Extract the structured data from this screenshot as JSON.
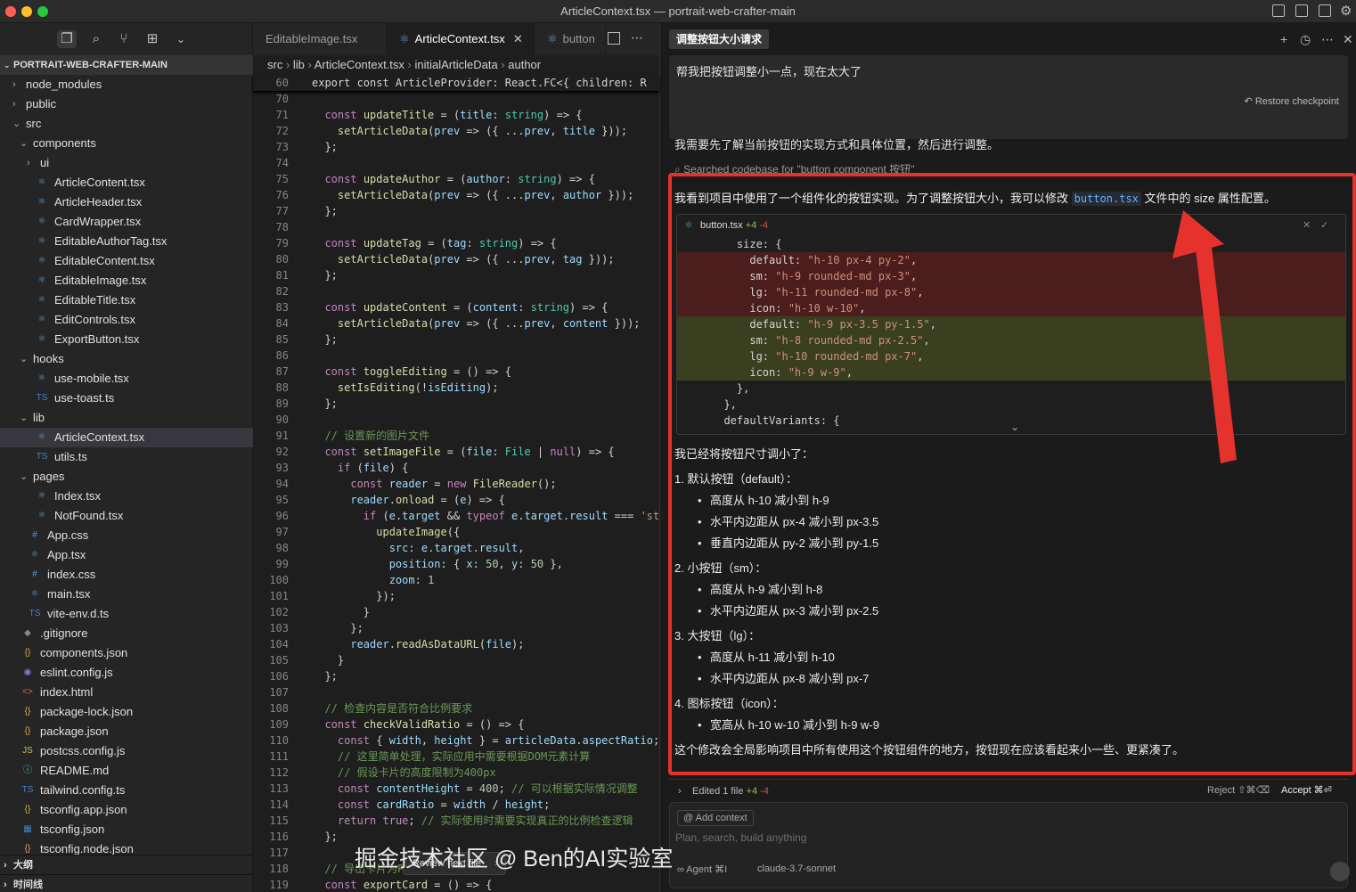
{
  "window": {
    "title": "ArticleContext.tsx — portrait-web-crafter-main"
  },
  "colors": {
    "accent": "#e5322d",
    "editor_bg": "#1e1e1e",
    "sidebar_bg": "#252526",
    "selected": "#37373d",
    "diff_removed": "#4b1d1d",
    "diff_added": "#3a3f1f"
  },
  "sidebar": {
    "header": "PORTRAIT-WEB-CRAFTER-MAIN",
    "tree": [
      {
        "label": "node_modules",
        "kind": "folder",
        "depth": 0,
        "open": false
      },
      {
        "label": "public",
        "kind": "folder",
        "depth": 0,
        "open": false
      },
      {
        "label": "src",
        "kind": "folder",
        "depth": 0,
        "open": true
      },
      {
        "label": "components",
        "kind": "folder",
        "depth": 1,
        "open": true
      },
      {
        "label": "ui",
        "kind": "folder",
        "depth": 2,
        "open": false
      },
      {
        "label": "ArticleContent.tsx",
        "kind": "react",
        "depth": 2
      },
      {
        "label": "ArticleHeader.tsx",
        "kind": "react",
        "depth": 2
      },
      {
        "label": "CardWrapper.tsx",
        "kind": "react",
        "depth": 2
      },
      {
        "label": "EditableAuthorTag.tsx",
        "kind": "react",
        "depth": 2
      },
      {
        "label": "EditableContent.tsx",
        "kind": "react",
        "depth": 2
      },
      {
        "label": "EditableImage.tsx",
        "kind": "react",
        "depth": 2
      },
      {
        "label": "EditableTitle.tsx",
        "kind": "react",
        "depth": 2
      },
      {
        "label": "EditControls.tsx",
        "kind": "react",
        "depth": 2
      },
      {
        "label": "ExportButton.tsx",
        "kind": "react",
        "depth": 2
      },
      {
        "label": "hooks",
        "kind": "folder",
        "depth": 1,
        "open": true
      },
      {
        "label": "use-mobile.tsx",
        "kind": "react",
        "depth": 2
      },
      {
        "label": "use-toast.ts",
        "kind": "ts",
        "depth": 2
      },
      {
        "label": "lib",
        "kind": "folder",
        "depth": 1,
        "open": true
      },
      {
        "label": "ArticleContext.tsx",
        "kind": "react",
        "depth": 2,
        "selected": true
      },
      {
        "label": "utils.ts",
        "kind": "ts",
        "depth": 2
      },
      {
        "label": "pages",
        "kind": "folder",
        "depth": 1,
        "open": true
      },
      {
        "label": "Index.tsx",
        "kind": "react",
        "depth": 2
      },
      {
        "label": "NotFound.tsx",
        "kind": "react",
        "depth": 2
      },
      {
        "label": "App.css",
        "kind": "css",
        "depth": 1
      },
      {
        "label": "App.tsx",
        "kind": "react",
        "depth": 1
      },
      {
        "label": "index.css",
        "kind": "css",
        "depth": 1
      },
      {
        "label": "main.tsx",
        "kind": "react",
        "depth": 1
      },
      {
        "label": "vite-env.d.ts",
        "kind": "ts",
        "depth": 1
      },
      {
        "label": ".gitignore",
        "kind": "git",
        "depth": 0
      },
      {
        "label": "components.json",
        "kind": "json",
        "depth": 0
      },
      {
        "label": "eslint.config.js",
        "kind": "eslint",
        "depth": 0
      },
      {
        "label": "index.html",
        "kind": "html",
        "depth": 0
      },
      {
        "label": "package-lock.json",
        "kind": "json",
        "depth": 0
      },
      {
        "label": "package.json",
        "kind": "json",
        "depth": 0
      },
      {
        "label": "postcss.config.js",
        "kind": "js",
        "depth": 0
      },
      {
        "label": "README.md",
        "kind": "info",
        "depth": 0
      },
      {
        "label": "tailwind.config.ts",
        "kind": "ts",
        "depth": 0
      },
      {
        "label": "tsconfig.app.json",
        "kind": "json",
        "depth": 0
      },
      {
        "label": "tsconfig.json",
        "kind": "tsconfig",
        "depth": 0
      },
      {
        "label": "tsconfig.node.json",
        "kind": "json",
        "depth": 0
      }
    ],
    "outline": "大纲",
    "timeline": "时间线"
  },
  "editor": {
    "tabs": [
      {
        "label": "EditableImage.tsx",
        "active": false
      },
      {
        "label": "ArticleContext.tsx",
        "active": true
      },
      {
        "label": "button",
        "active": false
      }
    ],
    "breadcrumb": [
      "src",
      "lib",
      "ArticleContext.tsx",
      "initialArticleData",
      "author"
    ],
    "sticky_line": {
      "num": "60",
      "text": "export const ArticleProvider: React.FC<{ children: R"
    },
    "lines": [
      {
        "n": "70",
        "h": ""
      },
      {
        "n": "71",
        "h": "  <span class='k'>const</span> <span class='f'>updateTitle</span> = (<span class='v'>title</span>: <span class='t'>string</span>) => {"
      },
      {
        "n": "72",
        "h": "    <span class='f'>setArticleData</span>(<span class='v'>prev</span> => ({ ...<span class='v'>prev</span>, <span class='v'>title</span> }));"
      },
      {
        "n": "73",
        "h": "  };"
      },
      {
        "n": "74",
        "h": ""
      },
      {
        "n": "75",
        "h": "  <span class='k'>const</span> <span class='f'>updateAuthor</span> = (<span class='v'>author</span>: <span class='t'>string</span>) => {"
      },
      {
        "n": "76",
        "h": "    <span class='f'>setArticleData</span>(<span class='v'>prev</span> => ({ ...<span class='v'>prev</span>, <span class='v'>author</span> }));"
      },
      {
        "n": "77",
        "h": "  };"
      },
      {
        "n": "78",
        "h": ""
      },
      {
        "n": "79",
        "h": "  <span class='k'>const</span> <span class='f'>updateTag</span> = (<span class='v'>tag</span>: <span class='t'>string</span>) => {"
      },
      {
        "n": "80",
        "h": "    <span class='f'>setArticleData</span>(<span class='v'>prev</span> => ({ ...<span class='v'>prev</span>, <span class='v'>tag</span> }));"
      },
      {
        "n": "81",
        "h": "  };"
      },
      {
        "n": "82",
        "h": ""
      },
      {
        "n": "83",
        "h": "  <span class='k'>const</span> <span class='f'>updateContent</span> = (<span class='v'>content</span>: <span class='t'>string</span>) => {"
      },
      {
        "n": "84",
        "h": "    <span class='f'>setArticleData</span>(<span class='v'>prev</span> => ({ ...<span class='v'>prev</span>, <span class='v'>content</span> }));"
      },
      {
        "n": "85",
        "h": "  };"
      },
      {
        "n": "86",
        "h": ""
      },
      {
        "n": "87",
        "h": "  <span class='k'>const</span> <span class='f'>toggleEditing</span> = () => {"
      },
      {
        "n": "88",
        "h": "    <span class='f'>setIsEditing</span>(!<span class='v'>isEditing</span>);"
      },
      {
        "n": "89",
        "h": "  };"
      },
      {
        "n": "90",
        "h": ""
      },
      {
        "n": "91",
        "h": "  <span class='c'>// 设置新的图片文件</span>"
      },
      {
        "n": "92",
        "h": "  <span class='k'>const</span> <span class='f'>setImageFile</span> = (<span class='v'>file</span>: <span class='t'>File</span> | <span class='k'>null</span>) => {"
      },
      {
        "n": "93",
        "h": "    <span class='k'>if</span> (<span class='v'>file</span>) {"
      },
      {
        "n": "94",
        "h": "      <span class='k'>const</span> <span class='v'>reader</span> = <span class='k'>new</span> <span class='f'>FileReader</span>();"
      },
      {
        "n": "95",
        "h": "      <span class='v'>reader</span>.<span class='f'>onload</span> = (<span class='v'>e</span>) => {"
      },
      {
        "n": "96",
        "h": "        <span class='k'>if</span> (<span class='v'>e</span>.<span class='v'>target</span> && <span class='k'>typeof</span> <span class='v'>e</span>.<span class='v'>target</span>.<span class='v'>result</span> === <span class='s'>'st</span>"
      },
      {
        "n": "97",
        "h": "          <span class='f'>updateImage</span>({"
      },
      {
        "n": "98",
        "h": "            <span class='v'>src</span>: <span class='v'>e</span>.<span class='v'>target</span>.<span class='v'>result</span>,"
      },
      {
        "n": "99",
        "h": "            <span class='v'>position</span>: { <span class='v'>x</span>: <span class='n'>50</span>, <span class='v'>y</span>: <span class='n'>50</span> },"
      },
      {
        "n": "100",
        "h": "            <span class='v'>zoom</span>: <span class='n'>1</span>"
      },
      {
        "n": "101",
        "h": "          });"
      },
      {
        "n": "102",
        "h": "        }"
      },
      {
        "n": "103",
        "h": "      };"
      },
      {
        "n": "104",
        "h": "      <span class='v'>reader</span>.<span class='f'>readAsDataURL</span>(<span class='v'>file</span>);"
      },
      {
        "n": "105",
        "h": "    }"
      },
      {
        "n": "106",
        "h": "  };"
      },
      {
        "n": "107",
        "h": ""
      },
      {
        "n": "108",
        "h": "  <span class='c'>// 检查内容是否符合比例要求</span>"
      },
      {
        "n": "109",
        "h": "  <span class='k'>const</span> <span class='f'>checkValidRatio</span> = () => {"
      },
      {
        "n": "110",
        "h": "    <span class='k'>const</span> { <span class='v'>width</span>, <span class='v'>height</span> } = <span class='v'>articleData</span>.<span class='v'>aspectRatio</span>;"
      },
      {
        "n": "111",
        "h": "    <span class='c'>// 这里简单处理，实际应用中需要根据DOM元素计算</span>"
      },
      {
        "n": "112",
        "h": "    <span class='c'>// 假设卡片的高度限制为400px</span>"
      },
      {
        "n": "113",
        "h": "    <span class='k'>const</span> <span class='v'>contentHeight</span> = <span class='n'>400</span>; <span class='c'>// 可以根据实际情况调整</span>"
      },
      {
        "n": "114",
        "h": "    <span class='k'>const</span> <span class='v'>cardRatio</span> = <span class='v'>width</span> / <span class='v'>height</span>;"
      },
      {
        "n": "115",
        "h": "    <span class='k'>return</span> <span class='k'>true</span>; <span class='c'>// 实际使用时需要实现真正的比例检查逻辑</span>"
      },
      {
        "n": "116",
        "h": "  };"
      },
      {
        "n": "117",
        "h": ""
      },
      {
        "n": "118",
        "h": "  <span class='c'>// 导出卡片为P</span>"
      },
      {
        "n": "119",
        "h": "  <span class='k'>const</span> <span class='f'>exportCard</span> = () => {"
      }
    ],
    "review_next": "Review next file"
  },
  "chat": {
    "tab_title": "调整按钮大小请求",
    "user_message": "帮我把按钮调整小一点，现在太大了",
    "restore": "Restore checkpoint",
    "intro": "我需要先了解当前按钮的实现方式和具体位置，然后进行调整。",
    "searched": "Searched codebase for \"button component 按钮\"",
    "found_pre": "我看到项目中使用了一个组件化的按钮实现。为了调整按钮大小，我可以修改",
    "found_code": "button.tsx",
    "found_post": "文件中的 size 属性配置。",
    "diff": {
      "file": "button.tsx",
      "added": "+4",
      "removed": "-4",
      "lines": [
        {
          "type": "ctx",
          "h": "    size: {"
        },
        {
          "type": "del",
          "h": "      default: <span class='s'>\"h-10 px-4 py-2\"</span>,"
        },
        {
          "type": "del",
          "h": "      sm: <span class='s'>\"h-9 rounded-md px-3\"</span>,"
        },
        {
          "type": "del",
          "h": "      lg: <span class='s'>\"h-11 rounded-md px-8\"</span>,"
        },
        {
          "type": "del",
          "h": "      icon: <span class='s'>\"h-10 w-10\"</span>,"
        },
        {
          "type": "add",
          "h": "      default: <span class='s'>\"h-9 px-3.5 py-1.5\"</span>,"
        },
        {
          "type": "add",
          "h": "      sm: <span class='s'>\"h-8 rounded-md px-2.5\"</span>,"
        },
        {
          "type": "add",
          "h": "      lg: <span class='s'>\"h-10 rounded-md px-7\"</span>,"
        },
        {
          "type": "add",
          "h": "      icon: <span class='s'>\"h-9 w-9\"</span>,"
        },
        {
          "type": "ctx",
          "h": "    },"
        },
        {
          "type": "ctx",
          "h": "  },"
        },
        {
          "type": "ctx",
          "h": "  defaultVariants: {"
        }
      ]
    },
    "summary": [
      {
        "type": "p",
        "text": "我已经将按钮尺寸调小了："
      },
      {
        "type": "p",
        "text": "1. 默认按钮（default）："
      },
      {
        "type": "b",
        "text": "高度从 h-10 减小到 h-9"
      },
      {
        "type": "b",
        "text": "水平内边距从 px-4 减小到 px-3.5"
      },
      {
        "type": "b",
        "text": "垂直内边距从 py-2 减小到 py-1.5"
      },
      {
        "type": "p",
        "text": "2. 小按钮（sm）："
      },
      {
        "type": "b",
        "text": "高度从 h-9 减小到 h-8"
      },
      {
        "type": "b",
        "text": "水平内边距从 px-3 减小到 px-2.5"
      },
      {
        "type": "p",
        "text": "3. 大按钮（lg）："
      },
      {
        "type": "b",
        "text": "高度从 h-11 减小到 h-10"
      },
      {
        "type": "b",
        "text": "水平内边距从 px-8 减小到 px-7"
      },
      {
        "type": "p",
        "text": "4. 图标按钮（icon）："
      },
      {
        "type": "b",
        "text": "宽高从 h-10 w-10 减小到 h-9 w-9"
      },
      {
        "type": "p",
        "text": "这个修改会全局影响项目中所有使用这个按钮组件的地方，按钮现在应该看起来小一些、更紧凑了。"
      }
    ],
    "edited": "Edited 1 file",
    "edited_added": "+4",
    "edited_removed": "-4",
    "reject": "Reject ⇧⌘⌫",
    "accept": "Accept ⌘⏎",
    "add_context": "Add context",
    "placeholder": "Plan, search, build anything",
    "agent": "Agent ⌘I",
    "model": "claude-3.7-sonnet"
  },
  "watermark": "掘金技术社区 @ Ben的AI实验室"
}
